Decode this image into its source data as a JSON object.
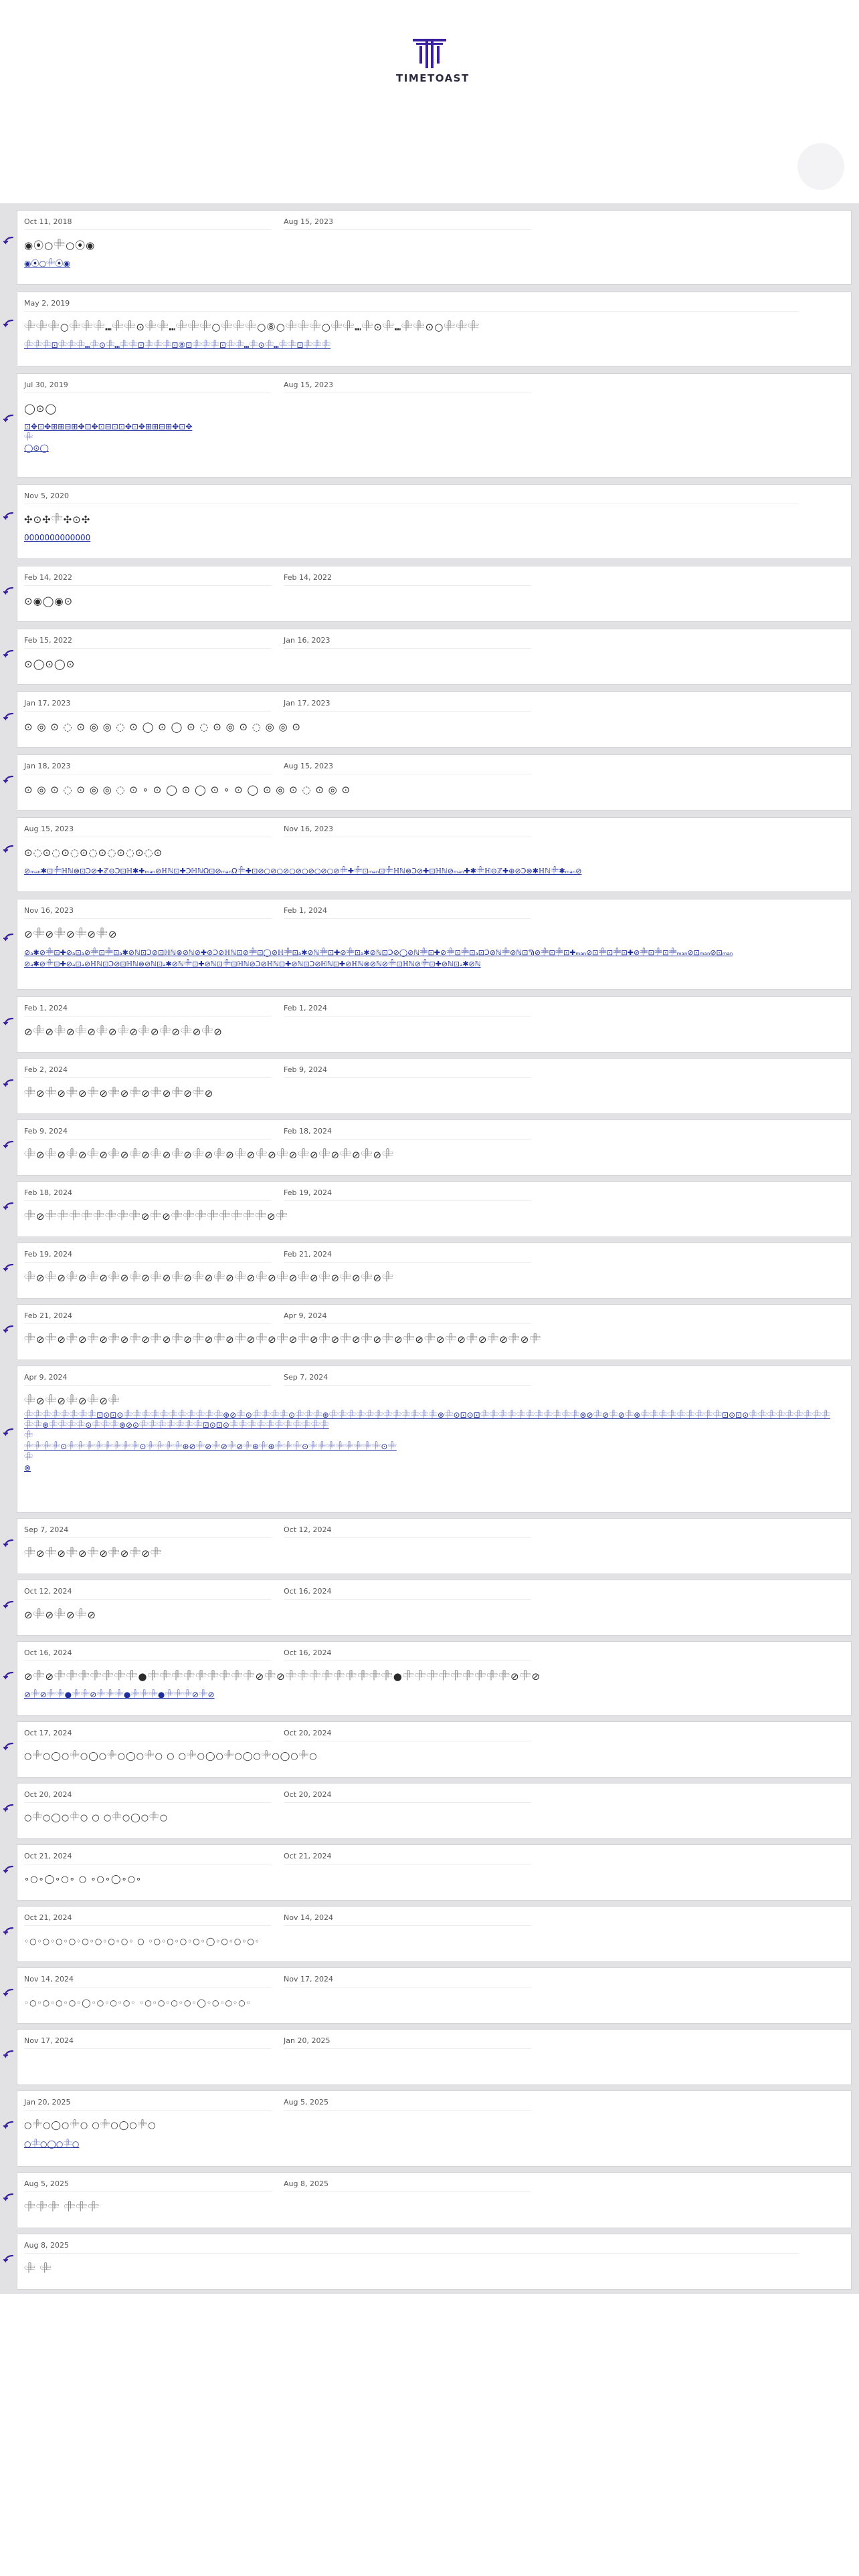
{
  "header": {
    "brand": "TIMETOAST"
  },
  "colors": {
    "accent": "#3a1f9e",
    "link": "#1f2e9e",
    "feed_bg": "#e2e2e4"
  },
  "icons": {
    "logo": "timetoast-logo-mark",
    "reply": "reply-arrow-icon"
  },
  "entries": [
    {
      "date1": "Oct 11, 2018",
      "date2": "Aug 15, 2023",
      "title": "◉⦿○𓄸○⦿◉",
      "link": "◉⦿○𓄸⦿◉"
    },
    {
      "date1": "May 2, 2019",
      "date2": "",
      "title": "𓄸𓄸𓄸○𓄸𓄸𓄸⑉𓄸𓄸⊙𓄸𓄸⑉𓄸𓄸𓄸○𓄸𓄸𓄸○⑧○𓄸𓄸𓄸○𓄸𓄸⑉𓄸⊙𓄸⑉𓄸𓄸⊙○𓄸𓄸𓄸",
      "link": "𓄸𓄸𓄸⊡𓄸𓄸𓄸⑉𓄸⊙𓄸⑉𓄸𓄸⊡𓄸𓄸𓄸⊡⑧⊡𓄸𓄸𓄸⊡𓄸𓄸⑉𓄸⊙𓄸⑉𓄸𓄸⊡𓄸𓄸𓄸"
    },
    {
      "date1": "Jul 30, 2019",
      "date2": "Aug 15, 2023",
      "title": "◯⊙◯",
      "link": "⊡✥⊡✥⊞⊞⊟⊞✥⊡✥⊡⊟⊡⊡✥⊡✥⊞⊞⊟⊞✥⊡✥",
      "sub1": "𓄸",
      "sub2": "◯⊙◯"
    },
    {
      "date1": "Nov 5, 2020",
      "date2": "",
      "title": "✣⊙✣𓄸✣⊙✣",
      "link": "0000000000000"
    },
    {
      "date1": "Feb 14, 2022",
      "date2": "Feb 14, 2022",
      "title": "⊙◉◯◉⊙"
    },
    {
      "date1": "Feb 15, 2022",
      "date2": "Jan 16, 2023",
      "title": "⊙◯⊙◯⊙"
    },
    {
      "date1": "Jan 17, 2023",
      "date2": "Jan 17, 2023",
      "title": "⊙ ◎ ⊙ ◌ ⊙ ◎ ◎ ◌ ⊙ ◯ ⊙ ◯ ⊙ ◌ ⊙ ◎ ⊙ ◌ ◎ ◎ ⊙"
    },
    {
      "date1": "Jan 18, 2023",
      "date2": "Aug 15, 2023",
      "title": "⊙ ◎ ⊙ ◌ ⊙ ◎ ◎ ◌ ⊙ ∘ ⊙ ◯ ⊙ ◯ ⊙ ∘ ⊙ ◯ ⊙ ◎ ⊙ ◌ ⊙ ◎ ⊙"
    },
    {
      "date1": "Aug 15, 2023",
      "date2": "Nov 16, 2023",
      "title": "⊙◌⊙◌⊙◌⊙◌⊙◌⊙◌⊙◌⊙",
      "link": "⊘ₘₐₙ✱⊡𓄸ℍℕ⊗⊡Ͻ⊘✚ℤ⊖Ͻ⊡ℍ✱✚ₘₐₙ⊘ℍℕ⊡✚ϽℍℕΩ⊡⊘ₘₐₙΩ𓄸✚⊡⊘○⊘○⊘○⊘○⊘○⊘○⊘𓄸✚𓄸⊡ₘₐₙ⊡𓄸ℍℕ⊗Ͻ⊘✚⊡ℍℕ⊘ₘₐₙ✚✱𓄸ℍ⊖ℤ✚⊕⊘Ͻ⊗✱ℍℕ𓄸✱ₘₐₙ⊘"
    },
    {
      "date1": "Nov 16, 2023",
      "date2": "Feb 1, 2024",
      "title": "⊘𓄸⊘𓄸⊘𓄸⊘𓄸⊘",
      "link": "⊘ₐ✱⊘𓄸⊡✚⊘ₐ⊡ₐ⊘𓄸⊡𓄸⊡ₐ✱⊘ℕ⊡Ͻ⊘⊡ℍℕ⊗⊘ℕ⊘✚⊘Ͻ⊘ℍℕ⊡⊘𓄸⊡◯⊘ℍ𓄸⊡ₐ✱⊘ℕ𓄸⊡✚⊘𓄸⊡ₐ✱⊘ℕ⊡Ͻ⊘◯⊘ℕ𓄸⊡✚⊘𓄸⊡𓄸⊡ₐ⊡Ͻ⊘ℕ𓄸⊘ℕ⊡Ϡ⊘𓄸⊡𓄸⊡✚ₘₐₙ⊘⊡𓄸⊡𓄸⊡✚⊘𓄸⊡𓄸⊡𓄸ₘₐₙ⊘⊡ₘₐₙ⊘⊡ₘₐₙ",
      "link2": "⊘ₐ✱⊘𓄸⊡✚⊘ₐ⊡ₐ⊘ℍℕ⊡Ͻ⊘⊡ℍℕ⊗⊘ℕ⊡ₐ✱⊘ℕ𓄸⊡✚⊘ℕ⊡𓄸⊡ℍℕ⊘Ͻ⊘ℍℕ⊡✚⊘ℕ⊡Ͻ⊘ℍℕ⊡✚⊘ℍℕ⊗⊘ℕ⊘𓄸⊡ℍℕ⊘𓄸⊡✚⊘ℕ⊡ₐ✱⊘ℕ"
    },
    {
      "date1": "Feb 1, 2024",
      "date2": "Feb 1, 2024",
      "title": "⊘𓄸⊘𓄸⊘𓄸⊘𓄸⊘𓄸⊘𓄸⊘𓄸⊘𓄸⊘𓄸⊘"
    },
    {
      "date1": "Feb 2, 2024",
      "date2": "Feb 9, 2024",
      "title": "𓄸⊘𓄸⊘𓄸⊘𓄸⊘𓄸⊘𓄸⊘𓄸⊘𓄸⊘𓄸⊘"
    },
    {
      "date1": "Feb 9, 2024",
      "date2": "Feb 18, 2024",
      "title": "𓄸⊘𓄸⊘𓄸⊘𓄸⊘𓄸⊘𓄸⊘𓄸⊘𓄸⊘𓄸⊘𓄸⊘𓄸⊘𓄸⊘𓄸⊘𓄸⊘𓄸⊘𓄸⊘𓄸⊘𓄸"
    },
    {
      "date1": "Feb 18, 2024",
      "date2": "Feb 19, 2024",
      "title": "𓄸⊘𓄸𓄸𓄸𓄸𓄸𓄸𓄸𓄸⊘𓄸⊘𓄸𓄸𓄸𓄸𓄸𓄸𓄸𓄸⊘𓄸"
    },
    {
      "date1": "Feb 19, 2024",
      "date2": "Feb 21, 2024",
      "title": "𓄸⊘𓄸⊘𓄸⊘𓄸⊘𓄸⊘𓄸⊘𓄸⊘𓄸⊘𓄸⊘𓄸⊘𓄸⊘𓄸⊘𓄸⊘𓄸⊘𓄸⊘𓄸⊘𓄸⊘𓄸"
    },
    {
      "date1": "Feb 21, 2024",
      "date2": "Apr 9, 2024",
      "title": "𓄸⊘𓄸⊘𓄸⊘𓄸⊘𓄸⊘𓄸⊘𓄸⊘𓄸⊘𓄸⊘𓄸⊘𓄸⊘𓄸⊘𓄸⊘𓄸⊘𓄸⊘𓄸⊘𓄸⊘𓄸⊘𓄸⊘𓄸⊘𓄸⊘𓄸⊘𓄸⊘𓄸⊘𓄸"
    },
    {
      "date1": "Apr 9, 2024",
      "date2": "Sep 7, 2024",
      "title": "𓄸⊘𓄸⊘𓄸⊘𓄸⊘𓄸",
      "link": "𓄸𓄸𓄸𓄸𓄸𓄸𓄸𓄸⊡⊙⊡⊙𓄸𓄸𓄸𓄸𓄸𓄸𓄸𓄸𓄸𓄸𓄸⊛⊘𓄸⊙𓄸𓄸𓄸𓄸⊙𓄸𓄸𓄸⊛𓄸𓄸𓄸𓄸𓄸𓄸𓄸𓄸𓄸𓄸𓄸𓄸⊛𓄸⊙⊡⊙⊡𓄸𓄸𓄸𓄸𓄸𓄸𓄸𓄸𓄸𓄸𓄸⊛⊘𓄸⊘𓄸⊘𓄸⊛𓄸𓄸𓄸𓄸𓄸𓄸𓄸𓄸𓄸⊡⊙⊡⊙𓄸𓄸𓄸𓄸𓄸𓄸𓄸𓄸𓄸𓄸𓄸⊛𓄸𓄸𓄸𓄸⊙𓄸𓄸𓄸⊛⊘⊙𓄸𓄸𓄸𓄸𓄸𓄸𓄸⊡⊙⊡⊙𓄸𓄸𓄸𓄸𓄸𓄸𓄸𓄸𓄸𓄸𓄸",
      "sub1": "𓄸",
      "link2": "𓄸𓄸𓄸𓄸⊙𓄸𓄸𓄸𓄸𓄸𓄸𓄸𓄸⊙𓄸𓄸𓄸𓄸⊛⊘𓄸⊘𓄸⊘𓄸⊘𓄸⊛𓄸⊛𓄸𓄸𓄸⊙𓄸𓄸𓄸𓄸𓄸𓄸𓄸𓄸⊙𓄸",
      "sub2": "𓄸",
      "sub3": "⊗"
    },
    {
      "date1": "Sep 7, 2024",
      "date2": "Oct 12, 2024",
      "title": "𓄸⊘𓄸⊘𓄸⊘𓄸⊘𓄸⊘𓄸⊘𓄸"
    },
    {
      "date1": "Oct 12, 2024",
      "date2": "Oct 16, 2024",
      "title": "⊘𓄸⊘𓄸⊘𓄸⊘"
    },
    {
      "date1": "Oct 16, 2024",
      "date2": "Oct 16, 2024",
      "title": "⊘𓄸⊘𓄸𓄸𓄸𓄸𓄸𓄸𓄸●𓄸𓄸𓄸𓄸𓄸𓄸𓄸𓄸𓄸⊘𓄸⊘𓄸𓄸𓄸𓄸𓄸𓄸𓄸𓄸𓄸●𓄸𓄸𓄸𓄸𓄸𓄸𓄸𓄸𓄸⊘𓄸⊘",
      "link": "⊘𓄸⊘𓄸𓄸●𓄸𓄸⊘𓄸𓄸𓄸●𓄸𓄸𓄸●𓄸𓄸𓄸⊘𓄸⊘"
    },
    {
      "date1": "Oct 17, 2024",
      "date2": "Oct 20, 2024",
      "title": "○𓄸○◯○𓄸○◯○𓄸○◯○𓄸○       ○       ○𓄸○◯○𓄸○◯○𓄸○◯○𓄸○"
    },
    {
      "date1": "Oct 20, 2024",
      "date2": "Oct 20, 2024",
      "title": "○𓄸○◯○𓄸○    ○    ○𓄸○◯○𓄸○"
    },
    {
      "date1": "Oct 21, 2024",
      "date2": "Oct 21, 2024",
      "title": "∘○∘◯∘○∘    ○    ∘○∘◯∘○∘"
    },
    {
      "date1": "Oct 21, 2024",
      "date2": "Nov 14, 2024",
      "title": "◦○◦○◦○◦○◦○◦○◦○◦○◦          ○          ◦○◦○◦○◦○◦◯◦○◦○◦○◦"
    },
    {
      "date1": "Nov 14, 2024",
      "date2": "Nov 17, 2024",
      "title": "◦○◦○◦○◦○◦◯◦○◦○◦○◦                              ◦○◦○◦○◦○◦◯◦○◦○◦○◦"
    },
    {
      "date1": "Nov 17, 2024",
      "date2": "Jan 20, 2025",
      "title": ""
    },
    {
      "date1": "Jan 20, 2025",
      "date2": "Aug 5, 2025",
      "title": "○𓄸○◯○𓄸○          ○𓄸○◯○𓄸○",
      "link": "○𓄸○◯○𓄸○"
    },
    {
      "date1": "Aug 5, 2025",
      "date2": "Aug 8, 2025",
      "title": "𓄸𓄸𓄸   𓄸𓄸𓄸"
    },
    {
      "date1": "Aug 8, 2025",
      "date2": "",
      "title": "𓄸   𓄸"
    }
  ]
}
